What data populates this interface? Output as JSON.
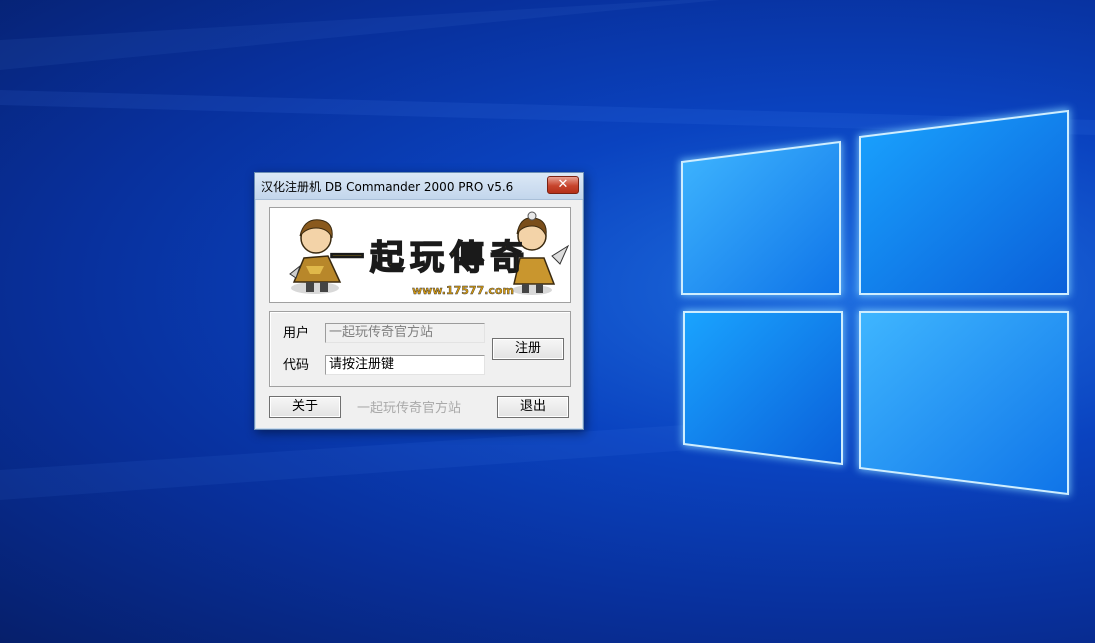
{
  "window": {
    "title": "汉化注册机 DB Commander 2000 PRO v5.6",
    "close_glyph": "✕"
  },
  "banner": {
    "logo_text": "一起玩傳奇",
    "url_text": "www.17577.com",
    "colors": {
      "logo_fill": "#f2c21a",
      "logo_outline": "#1a1a1a",
      "url_fill": "#d69a10"
    }
  },
  "form": {
    "user_label": "用户",
    "user_value": "一起玩传奇官方站",
    "code_label": "代码",
    "code_value": "请按注册键",
    "register_button": "注册"
  },
  "footer": {
    "about_button": "关于",
    "center_text": "一起玩传奇官方站",
    "exit_button": "退出"
  },
  "desktop": {
    "wallpaper": "windows-10-hero-logo",
    "colors": {
      "background": "#0a43c0",
      "logo_pane": "#1e9cff",
      "logo_glow": "#bfe6ff"
    }
  }
}
